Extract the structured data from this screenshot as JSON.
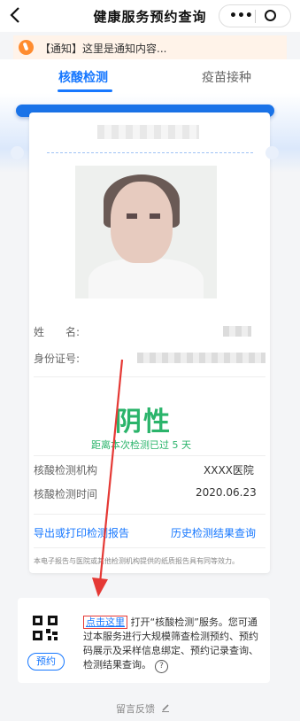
{
  "header": {
    "title": "健康服务预约查询",
    "more_glyph": "•••"
  },
  "notice": {
    "text": "【通知】这里是通知内容..."
  },
  "tabs": [
    {
      "label": "核酸检测",
      "active": true
    },
    {
      "label": "疫苗接种",
      "active": false
    }
  ],
  "person": {
    "name_label": "姓　　名:",
    "id_label": "身份证号:"
  },
  "result": {
    "status": "阴性",
    "since_text": "距离本次检测已过 5 天"
  },
  "details": [
    {
      "label": "核酸检测机构",
      "value": "XXXX医院"
    },
    {
      "label": "核酸检测时间",
      "value": "2020.06.23"
    }
  ],
  "links": {
    "export": "导出或打印检测报告",
    "history": "历史检测结果查询"
  },
  "disclaimer": "本电子报告与医院或其他检测机构提供的纸质报告具有同等效力。",
  "service": {
    "click_here": "点击这里",
    "description": " 打开“核酸检测”服务。您可通过本服务进行大规模筛查检测预约、预约码展示及采样信息绑定、预约记录查询、检测结果查询。",
    "book_label": "预约",
    "help_glyph": "?"
  },
  "footer": {
    "feedback": "留言反馈"
  },
  "colors": {
    "accent": "#1677ff",
    "negative": "#2bb46b",
    "highlight": "#e53935"
  }
}
